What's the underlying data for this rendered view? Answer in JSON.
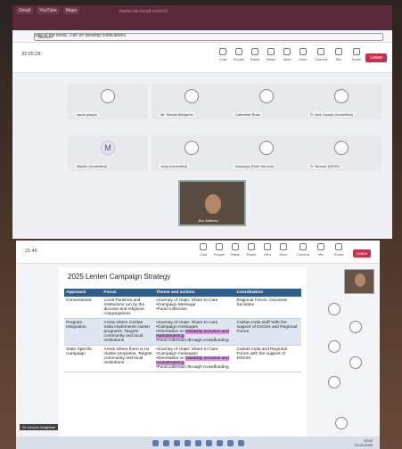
{
  "top_screen": {
    "tabs": [
      "Gmail",
      "YouTube",
      "Maps"
    ],
    "url": "teams.microsoft.com/v2/",
    "notice": "Stay in the know. Turn on desktop notifications.",
    "dismiss": "Dismiss",
    "timer": "32:05:28",
    "toolbar": [
      "Chat",
      "People",
      "Raise",
      "React",
      "View",
      "More",
      "Camera",
      "Mic",
      "Share"
    ],
    "leave_label": "Leave",
    "participants": [
      {
        "name": "sarah joseph",
        "initial": ""
      },
      {
        "name": "Mr. Selvan Benjamin",
        "initial": ""
      },
      {
        "name": "Catherine Rose",
        "initial": ""
      },
      {
        "name": "Fr. Anil Joseph (Unverified)",
        "initial": ""
      },
      {
        "name": "Madhu (Unverified)",
        "initial": "M"
      },
      {
        "name": "Judy (Unverified)",
        "initial": ""
      },
      {
        "name": "Aiswarya (Field Service)",
        "initial": ""
      },
      {
        "name": "Fr. Bennet (DSSS)",
        "initial": ""
      }
    ],
    "video_name": "Jinu Mathew"
  },
  "bottom_screen": {
    "timer": "21:46",
    "toolbar": [
      "Chat",
      "People",
      "Raise",
      "React",
      "View",
      "More",
      "Camera",
      "Mic",
      "Share"
    ],
    "leave_label": "Leave",
    "slide_title": "2025 Lenten Campaign Strategy",
    "table": {
      "headers": [
        "Approach",
        "Focus",
        "Theme and actions",
        "Coordination"
      ],
      "rows": [
        {
          "approach": "Conventional",
          "focus": "Local Parishes and Institutions run by the diocese and religious congregations",
          "actions": [
            "Journey of Hope: Share to Care",
            "Campaign Message",
            "Fund Collection"
          ],
          "coordination": "Regional Forum, Diocesan Societies"
        },
        {
          "approach": "Program Integration",
          "focus": "Areas where Caritas India implements cluster programs. Targets community and local institutions",
          "actions": [
            "Journey of Hope: Share to Care",
            "Campaign messages",
            "Orientation on Disability inclusion and mainstreaming",
            "Fund collection through crowdfunding"
          ],
          "coordination": "Caritas India staff With the support of DSSSs and Regional Forum"
        },
        {
          "approach": "State Specific Campaign",
          "focus": "Areas where there is no cluster programs. Targets community and local institutions",
          "actions": [
            "Journey of Hope: Share to Care",
            "Campaign messages",
            "Orientation on Disability inclusion and mainstreaming",
            "Fund collection through crowdfunding"
          ],
          "coordination": "Caritas India and Regional Forum with the support of DSSSs"
        }
      ],
      "highlight": "Disability inclusion and mainstreaming"
    },
    "speaker": "Dr. Lincoln Varghese",
    "clock_time": "22:02",
    "clock_date": "13-03-2025"
  }
}
